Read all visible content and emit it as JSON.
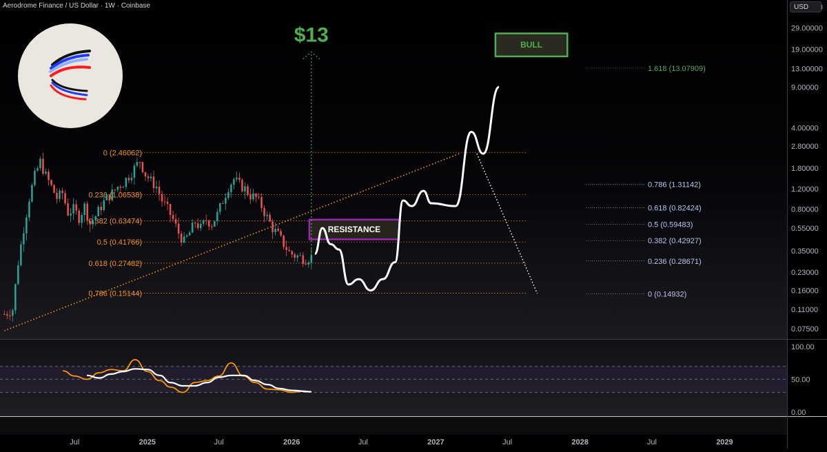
{
  "header": {
    "symbol_title": "Aerodrome Finance / US Dollar · 1W · Coinbase",
    "currency": "USD"
  },
  "logo": {
    "name": "aerodrome-logo-icon"
  },
  "colors": {
    "background": "#000000",
    "candle_up": "#26a69a",
    "candle_down": "#ef5350",
    "fib_left": "#f7931a",
    "fib_right": "#b7c7ef",
    "bull_green": "#4caf50",
    "resistance_purple": "#9c27b0",
    "projection": "#ffffff",
    "rsi": "#ff9800",
    "rsi_ma": "#ffffff",
    "target_dots": "#4caf50"
  },
  "annotations": {
    "target_price": "$13",
    "bull_label": "BULL",
    "resistance_label": "RESISTANCE"
  },
  "chart_data": [
    {
      "type": "candlestick",
      "title": "Aerodrome Finance / US Dollar · 1W · Coinbase",
      "scale": "log",
      "y_unit": "USD",
      "y_tick_labels": [
        "44.00000",
        "29.00000",
        "19.00000",
        "13.00000",
        "9.00000",
        "4.00000",
        "2.80000",
        "1.80000",
        "1.20000",
        "0.80000",
        "0.55000",
        "0.35000",
        "0.23000",
        "0.16000",
        "0.11000",
        "0.07500"
      ],
      "x_tick_labels": [
        "Jul",
        "2025",
        "Jul",
        "2026",
        "Jul",
        "2027",
        "Jul",
        "2028",
        "Jul",
        "2029"
      ],
      "price_path": [
        {
          "date": "2024-01-05",
          "price": 0.1
        },
        {
          "date": "2024-01-26",
          "price": 0.11
        },
        {
          "date": "2024-02-09",
          "price": 0.28
        },
        {
          "date": "2024-02-23",
          "price": 0.55
        },
        {
          "date": "2024-03-08",
          "price": 1.0
        },
        {
          "date": "2024-03-22",
          "price": 1.55
        },
        {
          "date": "2024-04-05",
          "price": 2.05
        },
        {
          "date": "2024-04-19",
          "price": 1.55
        },
        {
          "date": "2024-05-03",
          "price": 1.25
        },
        {
          "date": "2024-05-17",
          "price": 1.0
        },
        {
          "date": "2024-05-31",
          "price": 1.1
        },
        {
          "date": "2024-06-14",
          "price": 0.75
        },
        {
          "date": "2024-06-28",
          "price": 0.8
        },
        {
          "date": "2024-07-12",
          "price": 0.68
        },
        {
          "date": "2024-07-26",
          "price": 0.85
        },
        {
          "date": "2024-08-09",
          "price": 0.6
        },
        {
          "date": "2024-08-23",
          "price": 0.7
        },
        {
          "date": "2024-09-06",
          "price": 0.85
        },
        {
          "date": "2024-09-20",
          "price": 1.0
        },
        {
          "date": "2024-10-04",
          "price": 1.1
        },
        {
          "date": "2024-10-18",
          "price": 1.25
        },
        {
          "date": "2024-11-01",
          "price": 1.35
        },
        {
          "date": "2024-11-15",
          "price": 1.55
        },
        {
          "date": "2024-11-29",
          "price": 1.8
        },
        {
          "date": "2024-12-13",
          "price": 2.1
        },
        {
          "date": "2024-12-27",
          "price": 1.6
        },
        {
          "date": "2025-01-10",
          "price": 1.4
        },
        {
          "date": "2025-01-24",
          "price": 1.25
        },
        {
          "date": "2025-02-07",
          "price": 0.95
        },
        {
          "date": "2025-02-21",
          "price": 0.8
        },
        {
          "date": "2025-03-07",
          "price": 0.65
        },
        {
          "date": "2025-03-21",
          "price": 0.5
        },
        {
          "date": "2025-04-04",
          "price": 0.42
        },
        {
          "date": "2025-04-18",
          "price": 0.5
        },
        {
          "date": "2025-05-02",
          "price": 0.62
        },
        {
          "date": "2025-05-16",
          "price": 0.55
        },
        {
          "date": "2025-05-30",
          "price": 0.65
        },
        {
          "date": "2025-06-13",
          "price": 0.6
        },
        {
          "date": "2025-06-27",
          "price": 0.72
        },
        {
          "date": "2025-07-11",
          "price": 0.95
        },
        {
          "date": "2025-07-25",
          "price": 1.25
        },
        {
          "date": "2025-08-08",
          "price": 1.45
        },
        {
          "date": "2025-08-22",
          "price": 1.3
        },
        {
          "date": "2025-09-05",
          "price": 1.2
        },
        {
          "date": "2025-09-19",
          "price": 1.05
        },
        {
          "date": "2025-10-03",
          "price": 1.0
        },
        {
          "date": "2025-10-17",
          "price": 0.85
        },
        {
          "date": "2025-10-31",
          "price": 0.68
        },
        {
          "date": "2025-11-14",
          "price": 0.55
        },
        {
          "date": "2025-11-28",
          "price": 0.48
        },
        {
          "date": "2025-12-12",
          "price": 0.4
        },
        {
          "date": "2025-12-26",
          "price": 0.34
        },
        {
          "date": "2026-01-09",
          "price": 0.32
        },
        {
          "date": "2026-01-23",
          "price": 0.31
        },
        {
          "date": "2026-02-06",
          "price": 0.3
        },
        {
          "date": "2026-02-20",
          "price": 0.31
        }
      ],
      "fib_left": [
        {
          "label": "0 (2.46062)",
          "price": 2.46062
        },
        {
          "label": "0.236 (1.06538)",
          "price": 1.06538
        },
        {
          "label": "0.382 (0.63474)",
          "price": 0.63474
        },
        {
          "label": "0.5 (0.41766)",
          "price": 0.41766
        },
        {
          "label": "0.618 (0.27482)",
          "price": 0.27482
        },
        {
          "label": "0.786 (0.15144)",
          "price": 0.15144
        }
      ],
      "fib_right": [
        {
          "label": "1.618 (13.07909)",
          "price": 13.07909
        },
        {
          "label": "0.786 (1.31142)",
          "price": 1.31142
        },
        {
          "label": "0.618 (0.82424)",
          "price": 0.82424
        },
        {
          "label": "0.5 (0.59483)",
          "price": 0.59483
        },
        {
          "label": "0.382 (0.42927)",
          "price": 0.42927
        },
        {
          "label": "0.236 (0.28671)",
          "price": 0.28671
        },
        {
          "label": "0 (0.14932)",
          "price": 0.14932
        }
      ],
      "trendline": [
        {
          "date": "2024-01-05",
          "price": 0.072
        },
        {
          "date": "2027-03-01",
          "price": 2.4
        }
      ],
      "projection_path": [
        {
          "date": "2026-03-01",
          "price": 0.33
        },
        {
          "date": "2026-03-20",
          "price": 0.55
        },
        {
          "date": "2026-04-10",
          "price": 0.4
        },
        {
          "date": "2026-05-01",
          "price": 0.36
        },
        {
          "date": "2026-05-25",
          "price": 0.18
        },
        {
          "date": "2026-06-20",
          "price": 0.2
        },
        {
          "date": "2026-07-20",
          "price": 0.16
        },
        {
          "date": "2026-08-20",
          "price": 0.2
        },
        {
          "date": "2026-09-20",
          "price": 0.28
        },
        {
          "date": "2026-10-10",
          "price": 0.95
        },
        {
          "date": "2026-11-01",
          "price": 0.85
        },
        {
          "date": "2026-12-01",
          "price": 1.15
        },
        {
          "date": "2026-12-20",
          "price": 0.9
        },
        {
          "date": "2027-02-20",
          "price": 0.85
        },
        {
          "date": "2027-04-01",
          "price": 3.7
        },
        {
          "date": "2027-05-01",
          "price": 2.4
        },
        {
          "date": "2027-06-10",
          "price": 9.0
        }
      ],
      "bear_path": [
        {
          "date": "2027-04-15",
          "price": 2.4
        },
        {
          "date": "2027-09-15",
          "price": 0.15
        }
      ],
      "target_line": {
        "date": "2026-02-20",
        "from_price": 0.32,
        "to_price": 18.0
      },
      "zones": [
        {
          "label": "RESISTANCE",
          "from_date": "2026-02-15",
          "to_date": "2026-09-30",
          "low": 0.44,
          "high": 0.65
        },
        {
          "label": "BULL",
          "from_date": "2027-06-01",
          "to_date": "2027-11-30",
          "low": 16.5,
          "high": 26.0
        }
      ]
    },
    {
      "type": "line",
      "title": "",
      "ylim": [
        0,
        100
      ],
      "y_tick_labels": [
        "100.00",
        "50.00",
        "0.00"
      ],
      "band": [
        30,
        70
      ],
      "series": [
        {
          "role": "rsi",
          "values": [
            {
              "date": "2024-06-01",
              "v": 63
            },
            {
              "date": "2024-07-01",
              "v": 55
            },
            {
              "date": "2024-08-01",
              "v": 50
            },
            {
              "date": "2024-09-01",
              "v": 60
            },
            {
              "date": "2024-10-01",
              "v": 65
            },
            {
              "date": "2024-11-01",
              "v": 63
            },
            {
              "date": "2024-12-01",
              "v": 80
            },
            {
              "date": "2025-01-01",
              "v": 62
            },
            {
              "date": "2025-02-01",
              "v": 48
            },
            {
              "date": "2025-03-01",
              "v": 38
            },
            {
              "date": "2025-04-01",
              "v": 30
            },
            {
              "date": "2025-05-01",
              "v": 45
            },
            {
              "date": "2025-06-01",
              "v": 48
            },
            {
              "date": "2025-07-01",
              "v": 55
            },
            {
              "date": "2025-08-01",
              "v": 75
            },
            {
              "date": "2025-09-01",
              "v": 55
            },
            {
              "date": "2025-10-01",
              "v": 45
            },
            {
              "date": "2025-11-01",
              "v": 35
            },
            {
              "date": "2025-12-01",
              "v": 34
            },
            {
              "date": "2026-01-01",
              "v": 30
            },
            {
              "date": "2026-02-01",
              "v": 32
            },
            {
              "date": "2026-02-20",
              "v": 31
            }
          ]
        },
        {
          "role": "ma",
          "values": [
            {
              "date": "2024-08-01",
              "v": 56
            },
            {
              "date": "2024-09-01",
              "v": 52
            },
            {
              "date": "2024-10-01",
              "v": 58
            },
            {
              "date": "2024-11-01",
              "v": 62
            },
            {
              "date": "2024-12-01",
              "v": 66
            },
            {
              "date": "2025-01-01",
              "v": 65
            },
            {
              "date": "2025-02-01",
              "v": 56
            },
            {
              "date": "2025-03-01",
              "v": 45
            },
            {
              "date": "2025-04-01",
              "v": 40
            },
            {
              "date": "2025-05-01",
              "v": 40
            },
            {
              "date": "2025-06-01",
              "v": 45
            },
            {
              "date": "2025-07-01",
              "v": 53
            },
            {
              "date": "2025-08-01",
              "v": 56
            },
            {
              "date": "2025-09-01",
              "v": 56
            },
            {
              "date": "2025-10-01",
              "v": 48
            },
            {
              "date": "2025-11-01",
              "v": 42
            },
            {
              "date": "2025-12-01",
              "v": 36
            },
            {
              "date": "2026-01-01",
              "v": 33
            },
            {
              "date": "2026-02-20",
              "v": 31
            }
          ]
        }
      ]
    }
  ]
}
